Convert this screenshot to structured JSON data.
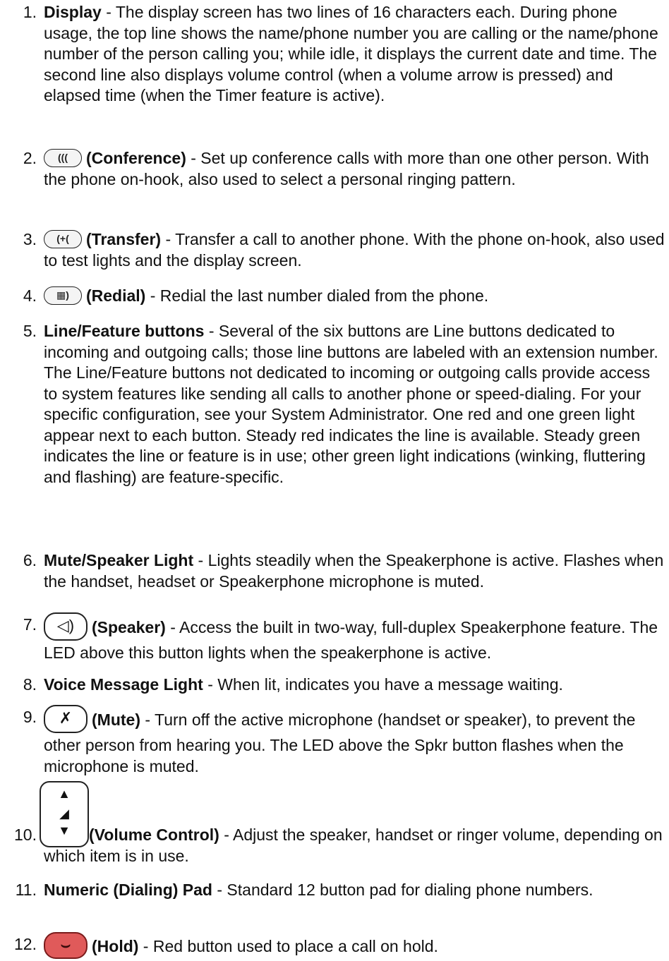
{
  "items": [
    {
      "num": "1.",
      "lead": "Display",
      "text": " - The display screen has two lines of 16 characters each. During phone usage, the top line shows the name/phone number you are calling or the name/phone number of the person calling you; while idle, it displays the current date and time. The second line also displays volume control (when a volume arrow is pressed) and elapsed time (when the Timer feature is active)."
    },
    {
      "num": "2.",
      "icon": "conference-icon",
      "icon_glyph": "(((",
      "lead": "(Conference)",
      "text": " - Set up conference calls with more than one other person. With the phone on-hook, also used to select a personal ringing pattern."
    },
    {
      "num": "3.",
      "icon": "transfer-icon",
      "icon_glyph": "(+(",
      "lead": "(Transfer)",
      "text": " - Transfer a call to another phone. With the phone on-hook, also used to test lights and the display screen."
    },
    {
      "num": "4.",
      "icon": "redial-icon",
      "icon_glyph": "▦)",
      "lead": "(Redial)",
      "text": " - Redial the last number dialed from the phone."
    },
    {
      "num": "5.",
      "lead": "Line/Feature buttons",
      "text": " - Several of the six buttons are Line buttons dedicated to incoming and outgoing calls; those line buttons are labeled with an extension number. The Line/Feature buttons not dedicated to incoming or outgoing calls provide access to system features like sending all calls to another phone or speed-dialing. For your specific configuration, see your System Administrator. One red and one green light appear next to each button. Steady red indicates the line is available. Steady green indicates the line or feature is in use; other green light indications (winking, fluttering and flashing) are feature-specific."
    },
    {
      "num": "6.",
      "lead": "Mute/Speaker Light",
      "text": " - Lights steadily when the Speakerphone is active. Flashes when the handset, headset or Speakerphone microphone is muted."
    },
    {
      "num": "7.",
      "icon": "speaker-icon",
      "icon_glyph": "◁)",
      "lead": "(Speaker)",
      "text": " - Access the built in two-way, full-duplex Speakerphone feature. The LED above this button lights when the speakerphone is active."
    },
    {
      "num": "8.",
      "lead": "Voice Message Light",
      "text": " - When lit, indicates you have a message waiting."
    },
    {
      "num": "9.",
      "icon": "mute-icon",
      "icon_glyph": "✗",
      "lead": "(Mute)",
      "text": " - Turn off the active microphone (handset or speaker), to prevent the other person from hearing you. The LED above the Spkr button flashes when the microphone is muted."
    },
    {
      "num": "10.",
      "icon": "volume-control-icon",
      "lead": "(Volume Control)",
      "text": " - Adjust the speaker, handset or ringer volume, depending on which item is in use."
    },
    {
      "num": "11.",
      "lead": "Numeric (Dialing) Pad",
      "text": " - Standard 12 button pad for dialing phone numbers."
    },
    {
      "num": "12.",
      "icon": "hold-icon",
      "icon_glyph": "⌣",
      "lead": "(Hold)",
      "text": " - Red button used to place a call on hold."
    }
  ],
  "icon_colors": {
    "hold": "#e05a5a",
    "outline": "#222222"
  }
}
